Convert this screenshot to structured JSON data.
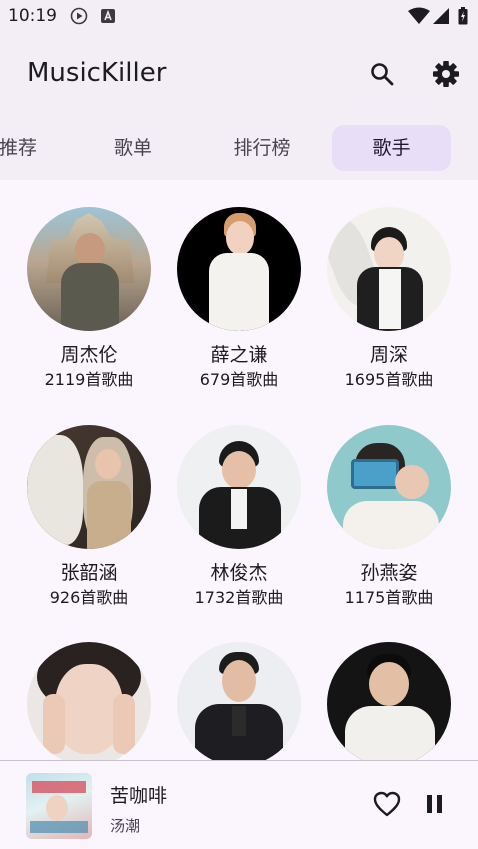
{
  "status_bar": {
    "time": "10:19",
    "icons": [
      "play-circle-icon",
      "a-badge-icon",
      "wifi-icon",
      "signal-icon",
      "battery-icon"
    ]
  },
  "app_bar": {
    "title": "MusicKiller",
    "actions": [
      "search-icon",
      "settings-icon"
    ]
  },
  "tabs": [
    {
      "label": "推荐",
      "active": false
    },
    {
      "label": "歌单",
      "active": false
    },
    {
      "label": "排行榜",
      "active": false
    },
    {
      "label": "歌手",
      "active": true
    }
  ],
  "artists": [
    {
      "name": "周杰伦",
      "count": "2119首歌曲"
    },
    {
      "name": "薛之谦",
      "count": "679首歌曲"
    },
    {
      "name": "周深",
      "count": "1695首歌曲"
    },
    {
      "name": "张韶涵",
      "count": "926首歌曲"
    },
    {
      "name": "林俊杰",
      "count": "1732首歌曲"
    },
    {
      "name": "孙燕姿",
      "count": "1175首歌曲"
    },
    {
      "name": "",
      "count": ""
    },
    {
      "name": "",
      "count": ""
    },
    {
      "name": "",
      "count": ""
    }
  ],
  "player": {
    "title": "苦咖啡",
    "artist": "汤潮",
    "controls": [
      "heart-outline-icon",
      "pause-icon"
    ]
  },
  "colors": {
    "accent_tab": "#e8def8",
    "bar_bg": "#f3eef6",
    "page_bg": "#fbf6fd"
  }
}
